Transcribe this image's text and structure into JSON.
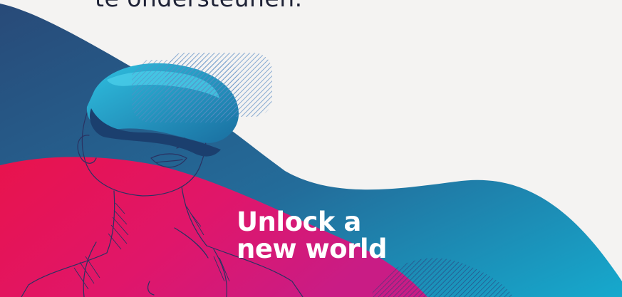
{
  "banner": {
    "cut_off_text": "te ondersteunen.",
    "headline_line1": "Unlock a",
    "headline_line2": "new world",
    "illustration": "vr-headset-person-illustration"
  },
  "colors": {
    "background": "#f4f3f2",
    "wave_blue_dark": "#2a4f7e",
    "wave_teal": "#19a3c6",
    "wave_magenta": "#e8114f",
    "wave_pink": "#d91a79",
    "headline_text": "#ffffff",
    "body_text": "#1e2236"
  }
}
